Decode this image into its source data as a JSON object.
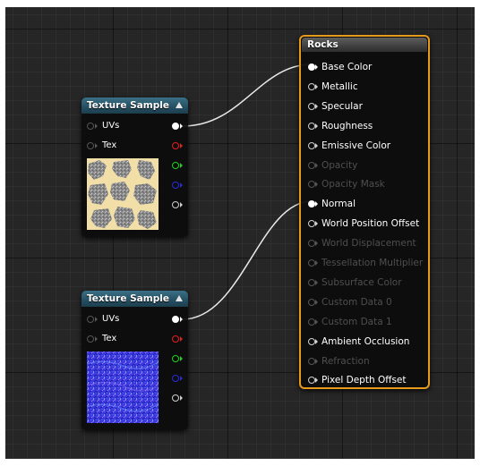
{
  "texture_sample_1": {
    "title": "Texture Sample",
    "inputs": [
      "UVs",
      "Tex"
    ],
    "output_colors": [
      "#ffffff",
      "#e02020",
      "#20d020",
      "#2a2ad8",
      "#cfcfcf"
    ]
  },
  "texture_sample_2": {
    "title": "Texture Sample",
    "inputs": [
      "UVs",
      "Tex"
    ],
    "output_colors": [
      "#ffffff",
      "#e02020",
      "#20d020",
      "#2a2ad8",
      "#cfcfcf"
    ]
  },
  "material_node": {
    "title": "Rocks",
    "border_color": "#e89a1a",
    "pins": [
      {
        "label": "Base Color",
        "enabled": true,
        "connected": true
      },
      {
        "label": "Metallic",
        "enabled": true,
        "connected": false
      },
      {
        "label": "Specular",
        "enabled": true,
        "connected": false
      },
      {
        "label": "Roughness",
        "enabled": true,
        "connected": false
      },
      {
        "label": "Emissive Color",
        "enabled": true,
        "connected": false
      },
      {
        "label": "Opacity",
        "enabled": false,
        "connected": false
      },
      {
        "label": "Opacity Mask",
        "enabled": false,
        "connected": false
      },
      {
        "label": "Normal",
        "enabled": true,
        "connected": true
      },
      {
        "label": "World Position Offset",
        "enabled": true,
        "connected": false
      },
      {
        "label": "World Displacement",
        "enabled": false,
        "connected": false
      },
      {
        "label": "Tessellation Multiplier",
        "enabled": false,
        "connected": false
      },
      {
        "label": "Subsurface Color",
        "enabled": false,
        "connected": false
      },
      {
        "label": "Custom Data 0",
        "enabled": false,
        "connected": false
      },
      {
        "label": "Custom Data 1",
        "enabled": false,
        "connected": false
      },
      {
        "label": "Ambient Occlusion",
        "enabled": true,
        "connected": false
      },
      {
        "label": "Refraction",
        "enabled": false,
        "connected": false
      },
      {
        "label": "Pixel Depth Offset",
        "enabled": true,
        "connected": false
      }
    ]
  },
  "wire_color": "#e8e8e8",
  "header_color": "#2a5a70"
}
